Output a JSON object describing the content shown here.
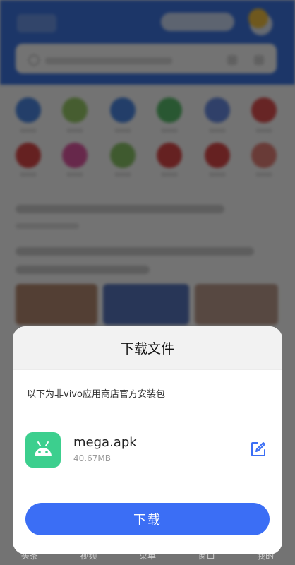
{
  "sheet": {
    "title": "下载文件",
    "notice": "以下为非vivo应用商店官方安装包",
    "file": {
      "name": "mega.apk",
      "size": "40.67MB"
    },
    "download_label": "下载"
  },
  "bottom_nav": [
    "头条",
    "视频",
    "菜单",
    "窗口",
    "我的"
  ],
  "colors": {
    "header_blue": "#3f78e6",
    "android_green": "#3ccf8e",
    "primary_blue": "#3b6ef5"
  }
}
